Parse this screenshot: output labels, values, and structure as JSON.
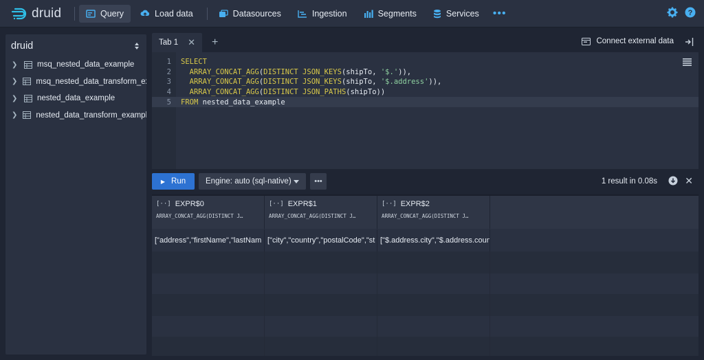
{
  "app": {
    "logo_text": "druid"
  },
  "nav": [
    {
      "label": "Query",
      "icon": "query-icon",
      "active": true
    },
    {
      "label": "Load data",
      "icon": "upload-icon",
      "active": false
    },
    {
      "label": "Datasources",
      "icon": "datasources-icon",
      "active": false
    },
    {
      "label": "Ingestion",
      "icon": "ingestion-icon",
      "active": false
    },
    {
      "label": "Segments",
      "icon": "segments-icon",
      "active": false
    },
    {
      "label": "Services",
      "icon": "services-icon",
      "active": false
    }
  ],
  "nav_more": "•••",
  "sidebar": {
    "database": "druid",
    "tables": [
      "msq_nested_data_example",
      "msq_nested_data_transform_ex",
      "nested_data_example",
      "nested_data_transform_exampl"
    ]
  },
  "tabs": [
    {
      "label": "Tab 1"
    }
  ],
  "connect_label": "Connect external data",
  "editor": {
    "line_numbers": [
      "1",
      "2",
      "3",
      "4",
      "5"
    ]
  },
  "run": {
    "run_label": "Run",
    "engine_label": "Engine: auto (sql-native)",
    "more_label": "•••",
    "result_info": "1 result in 0.08s"
  },
  "results": {
    "columns": [
      {
        "name": "EXPR$0",
        "expr": "ARRAY_CONCAT_AGG(DISTINCT J…",
        "type_icon": "[··]"
      },
      {
        "name": "EXPR$1",
        "expr": "ARRAY_CONCAT_AGG(DISTINCT J…",
        "type_icon": "[··]"
      },
      {
        "name": "EXPR$2",
        "expr": "ARRAY_CONCAT_AGG(DISTINCT J…",
        "type_icon": "[··]"
      }
    ],
    "row": [
      "[\"address\",\"firstName\",\"lastNam",
      "[\"city\",\"country\",\"postalCode\",\"st",
      "[\"$.address.city\",\"$.address.coun"
    ]
  },
  "colors": {
    "accent": "#48aff0",
    "run_button": "#2d72d2",
    "keyword": "#d9c94a",
    "string": "#8fd1a0",
    "background": "#1f2533",
    "panel": "#2a3141"
  }
}
